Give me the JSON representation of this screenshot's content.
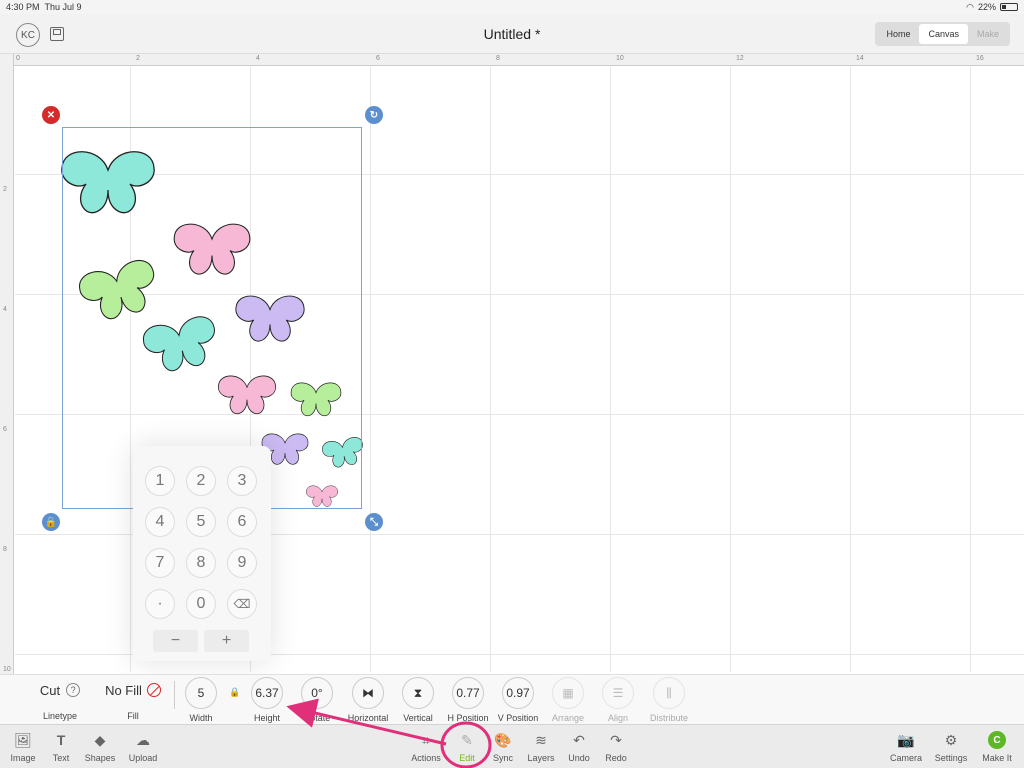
{
  "status": {
    "time": "4:30 PM",
    "date": "Thu Jul 9",
    "battery": "22%"
  },
  "header": {
    "avatar": "KC",
    "title": "Untitled *",
    "tabs": [
      {
        "label": "Home"
      },
      {
        "label": "Canvas",
        "active": true
      },
      {
        "label": "Make",
        "disabled": true
      }
    ]
  },
  "rulers": {
    "top": [
      "0",
      "2",
      "4",
      "6",
      "8",
      "10",
      "12",
      "14",
      "16"
    ],
    "left": [
      "2",
      "4",
      "6",
      "8",
      "10"
    ]
  },
  "keypad": {
    "keys": [
      "1",
      "2",
      "3",
      "4",
      "5",
      "6",
      "7",
      "8",
      "9",
      "·",
      "0",
      "⌫"
    ],
    "minus": "−",
    "plus": "+"
  },
  "edit": {
    "linetype": {
      "value": "Cut",
      "label": "Linetype"
    },
    "fill": {
      "value": "No Fill",
      "label": "Fill"
    },
    "width": {
      "value": "5",
      "label": "Width"
    },
    "height": {
      "value": "6.37",
      "label": "Height"
    },
    "rotate": {
      "value": "0°",
      "label": "Rotate"
    },
    "horizontal": {
      "label": "Horizontal"
    },
    "vertical": {
      "label": "Vertical"
    },
    "hposition": {
      "value": "0.77",
      "label": "H Position"
    },
    "vposition": {
      "value": "0.97",
      "label": "V Position"
    },
    "arrange": {
      "label": "Arrange"
    },
    "align": {
      "label": "Align"
    },
    "distribute": {
      "label": "Distribute"
    }
  },
  "toolbar": {
    "image": "Image",
    "text": "Text",
    "shapes": "Shapes",
    "upload": "Upload",
    "actions": "Actions",
    "edit": "Edit",
    "sync": "Sync",
    "layers": "Layers",
    "undo": "Undo",
    "redo": "Redo",
    "camera": "Camera",
    "settings": "Settings",
    "makeit": "Make It"
  },
  "colors": {
    "accent": "#7ab317",
    "selection": "#5b8fd0",
    "annotation": "#e0307a",
    "delete": "#d42a2a"
  }
}
